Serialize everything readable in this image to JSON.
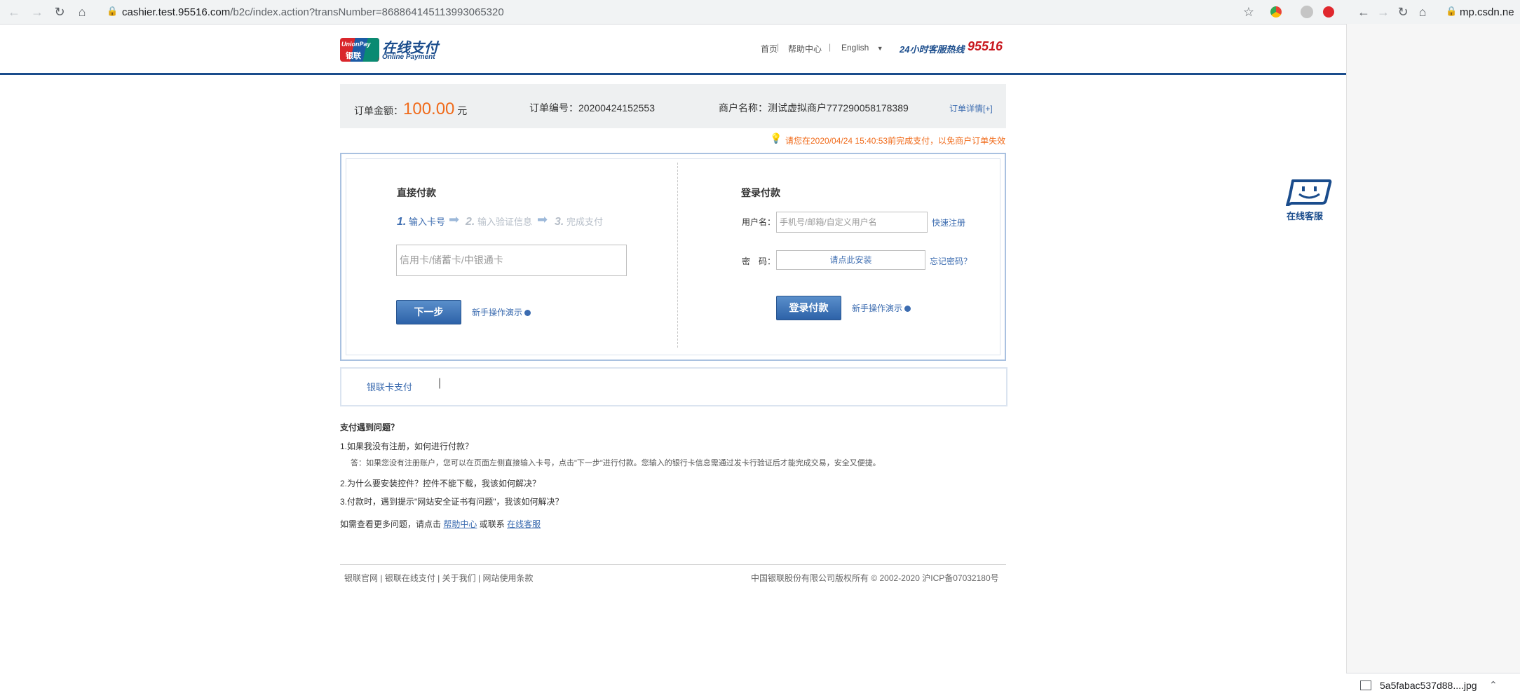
{
  "browser": {
    "url_host": "cashier.test.95516.com",
    "url_path": "/b2c/index.action?transNumber=868864145113993065320",
    "second_url": "mp.csdn.ne",
    "download_file": "5a5fabac537d88....jpg"
  },
  "header": {
    "logo_unionpay": "UnionPay",
    "logo_yinlian": "银联",
    "logo_title": "在线支付",
    "logo_subtitle": "Online Payment",
    "nav_home": "首页",
    "nav_help": "帮助中心",
    "nav_lang": "English",
    "hotline_label": "24小时客服热线",
    "hotline_number": "95516"
  },
  "order": {
    "amount_label": "订单金额：",
    "amount": "100.00",
    "amount_unit": "元",
    "number_label": "订单编号：",
    "number": "20200424152553",
    "merchant_label": "商户名称：",
    "merchant": "测试虚拟商户777290058178389",
    "details_link": "订单详情[+]",
    "deadline_notice": "请您在2020/04/24 15:40:53前完成支付，以免商户订单失效"
  },
  "direct_pay": {
    "title": "直接付款",
    "step1_num": "1.",
    "step1": "输入卡号",
    "step2_num": "2.",
    "step2": "输入验证信息",
    "step3_num": "3.",
    "step3": "完成支付",
    "card_placeholder": "信用卡/储蓄卡/中银通卡",
    "next_button": "下一步",
    "demo_link": "新手操作演示"
  },
  "login_pay": {
    "title": "登录付款",
    "username_label": "用户名：",
    "username_placeholder": "手机号/邮箱/自定义用户名",
    "register_link": "快速注册",
    "password_label": "密　码：",
    "password_install": "请点此安装",
    "forgot_link": "忘记密码？",
    "login_button": "登录付款",
    "demo_link": "新手操作演示"
  },
  "payment_methods": {
    "tab_unionpay": "银联卡支付"
  },
  "faq": {
    "title": "支付遇到问题？",
    "q1": "1.如果我没有注册，如何进行付款？",
    "a1": "答：如果您没有注册账户，您可以在页面左侧直接输入卡号，点击\"下一步\"进行付款。您输入的银行卡信息需通过发卡行验证后才能完成交易，安全又便捷。",
    "q2": "2.为什么要安装控件？控件不能下载，我该如何解决？",
    "q3": "3.付款时，遇到提示\"网站安全证书有问题\"，我该如何解决？",
    "more_prefix": "如需查看更多问题，请点击",
    "more_help": "帮助中心",
    "more_or": "或联系",
    "more_service": "在线客服"
  },
  "footer": {
    "link1": "银联官网",
    "link2": "银联在线支付",
    "link3": "关于我们",
    "link4": "网站使用条款",
    "copyright": "中国银联股份有限公司版权所有 © 2002-2020  沪ICP备07032180号"
  },
  "service_widget": {
    "label": "在线客服"
  },
  "colors": {
    "brand_blue": "#1a4c8c",
    "accent_orange": "#f06b1b",
    "link_blue": "#3c6cb0"
  }
}
